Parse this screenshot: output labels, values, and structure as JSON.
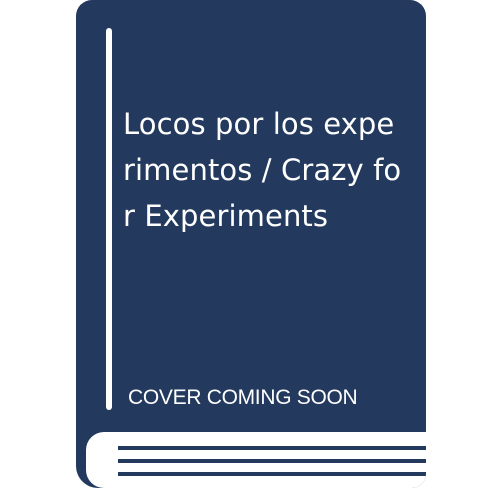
{
  "book_cover": {
    "title": "Locos por los experimentos / Crazy for Experiments",
    "placeholder_text": "COVER COMING SOON",
    "cover_color": "#233a5e",
    "text_color": "#ffffff",
    "icon": "book-icon"
  }
}
